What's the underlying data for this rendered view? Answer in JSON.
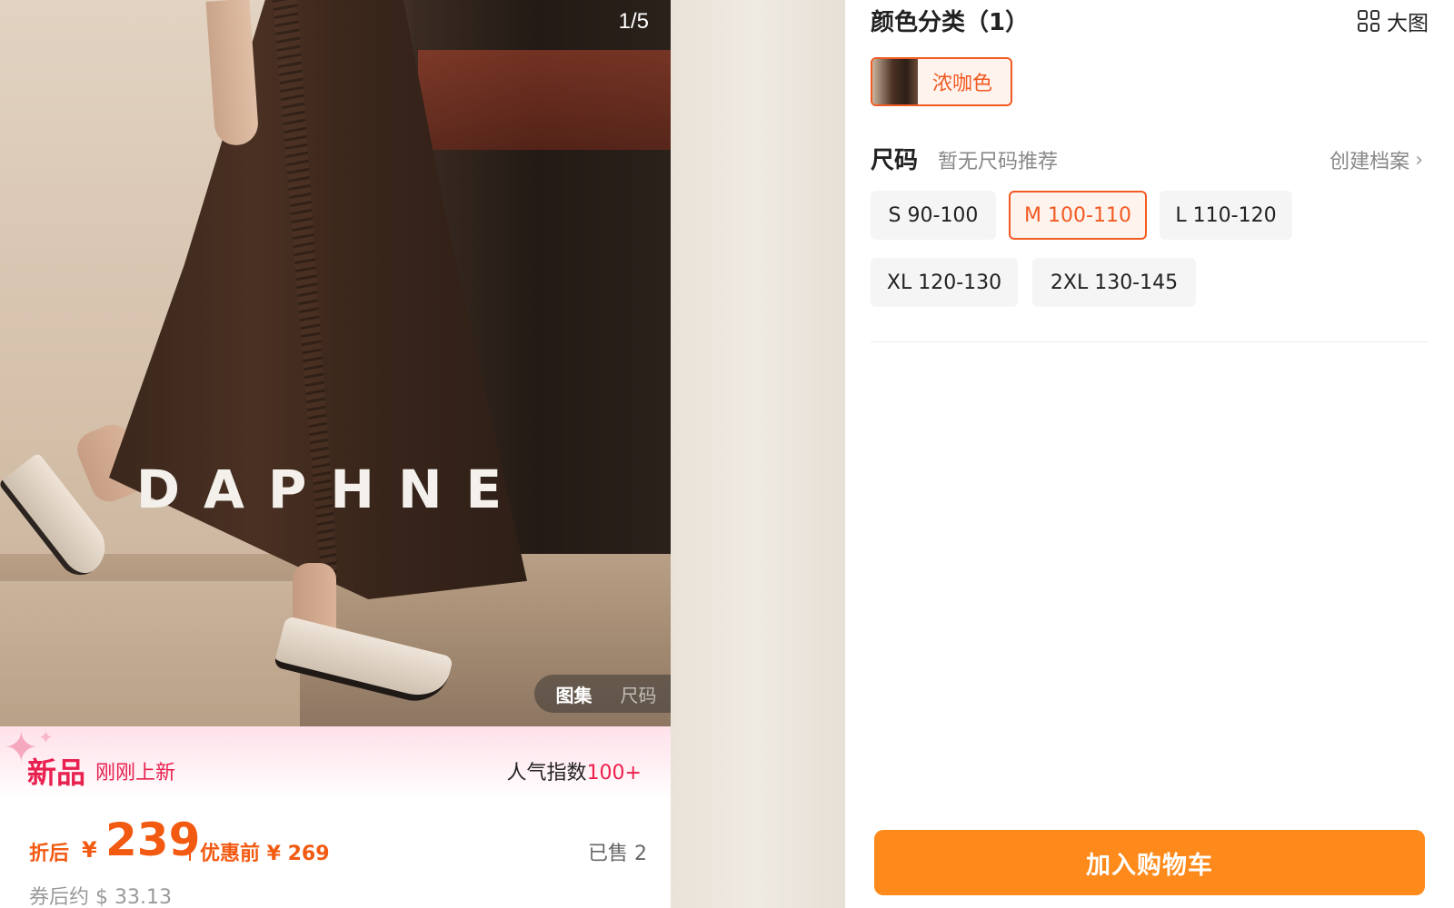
{
  "gallery": {
    "brand": "DAPHNE",
    "counter": "1/5",
    "tabs": [
      "图集",
      "尺码"
    ]
  },
  "banner": {
    "new_label": "新品",
    "new_sub": "刚刚上新",
    "pop_label": "人气指数",
    "pop_value": "100+"
  },
  "price": {
    "discount_label": "折后",
    "currency": "¥",
    "value": "239",
    "original_label": "优惠前 ¥ 269",
    "sold": "已售 2",
    "approx": "券后约 $ 33.13"
  },
  "color": {
    "title": "颜色分类（1）",
    "big_pic_label": "大图",
    "options": [
      {
        "name": "浓咖色",
        "selected": true
      }
    ]
  },
  "size": {
    "title": "尺码",
    "hint": "暂无尺码推荐",
    "profile_link": "创建档案",
    "options": [
      {
        "label": "S 90-100",
        "selected": false
      },
      {
        "label": "M 100-110",
        "selected": true
      },
      {
        "label": "L 110-120",
        "selected": false
      },
      {
        "label": "XL 120-130",
        "selected": false
      },
      {
        "label": "2XL 130-145",
        "selected": false
      }
    ]
  },
  "cart": {
    "button_label": "加入购物车"
  },
  "colors": {
    "accent_orange": "#f15a22",
    "cart_orange": "#fd8a1a",
    "new_pink": "#e8204f"
  }
}
